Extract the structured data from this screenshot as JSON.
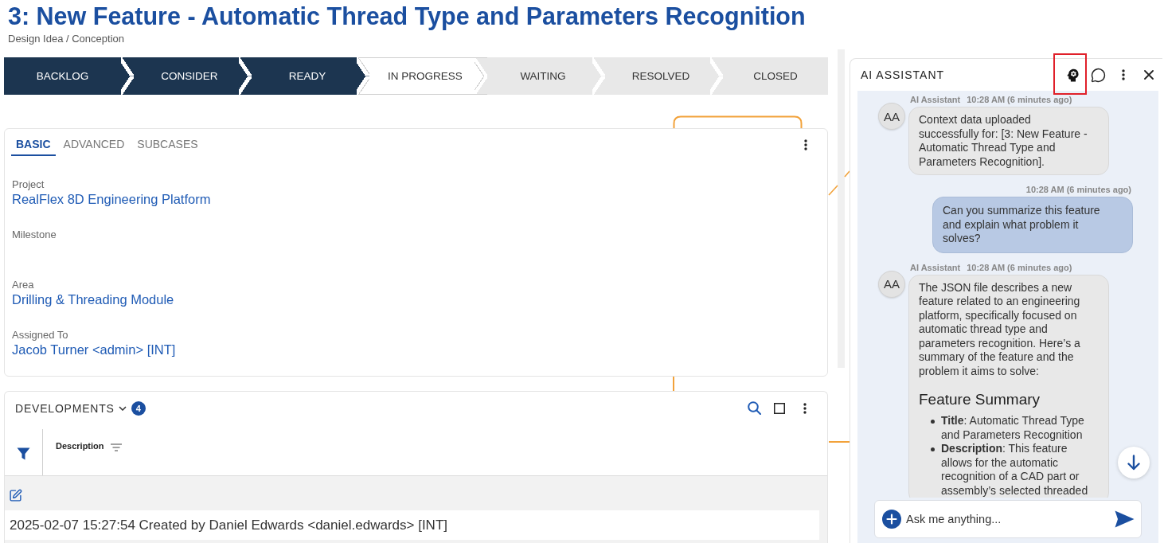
{
  "header": {
    "title": "3: New Feature - Automatic Thread Type and Parameters Recognition",
    "breadcrumb": "Design Idea / Conception"
  },
  "workflow": [
    {
      "label": "BACKLOG",
      "completed": true,
      "selected": false
    },
    {
      "label": "CONSIDER",
      "completed": true,
      "selected": false
    },
    {
      "label": "READY",
      "completed": true,
      "selected": false
    },
    {
      "label": "IN PROGRESS",
      "completed": false,
      "selected": true
    },
    {
      "label": "WAITING",
      "completed": false,
      "selected": false
    },
    {
      "label": "RESOLVED",
      "completed": false,
      "selected": false
    },
    {
      "label": "CLOSED",
      "completed": false,
      "selected": false
    }
  ],
  "details_card": {
    "tabs": [
      {
        "label": "BASIC",
        "selected": true
      },
      {
        "label": "ADVANCED",
        "selected": false
      },
      {
        "label": "SUBCASES",
        "selected": false
      }
    ],
    "fields": [
      {
        "label": "Project",
        "value": "RealFlex 8D Engineering Platform"
      },
      {
        "label": "Milestone"
      },
      {
        "label": "Area",
        "value": "Drilling & Threading Module"
      },
      {
        "label": "Assigned To",
        "value": "Jacob Turner <admin> [INT]"
      }
    ]
  },
  "developments": {
    "title": "DEVELOPMENTS",
    "count": "4",
    "columns": [
      "Description"
    ],
    "rows": [
      "2025-02-07 15:27:54 Created by Daniel Edwards <daniel.edwards> [INT]"
    ]
  },
  "assistant": {
    "title": "AI ASSISTANT",
    "tools": [
      {
        "kind": "persona",
        "highlighted": true
      },
      {
        "kind": "chat",
        "highlighted": false
      },
      {
        "kind": "menu",
        "highlighted": false
      },
      {
        "kind": "close",
        "highlighted": false
      }
    ],
    "messages": [
      {
        "kind": "bot",
        "avatar": "AA",
        "sender": "AI Assistant",
        "time": "10:28 AM (6 minutes ago)",
        "blocks": [
          {
            "kind": "paragraph",
            "text": "Context data uploaded successfully for: [3: New Feature - Automatic Thread Type and Parameters Recognition]."
          }
        ]
      },
      {
        "kind": "user",
        "time": "10:28 AM (6 minutes ago)",
        "blocks": [
          {
            "kind": "paragraph",
            "text": "Can you summarize this feature and explain what problem it solves?"
          }
        ]
      },
      {
        "kind": "bot",
        "avatar": "AA",
        "sender": "AI Assistant",
        "time": "10:28 AM (6 minutes ago)",
        "blocks": [
          {
            "kind": "paragraph",
            "text": "The JSON file describes a new feature related to an engineering platform, specifically focused on automatic thread type and parameters recognition. Here’s a summary of the feature and the problem it aims to solve:"
          },
          {
            "kind": "heading",
            "text": "Feature Summary"
          },
          {
            "kind": "list",
            "items": [
              "**Title**: Automatic Thread Type and Parameters Recognition",
              "**Description**: This feature allows for the automatic recognition of a CAD part or assembly’s selected threaded"
            ]
          }
        ]
      }
    ],
    "input": {
      "placeholder": "Ask me anything..."
    }
  }
}
